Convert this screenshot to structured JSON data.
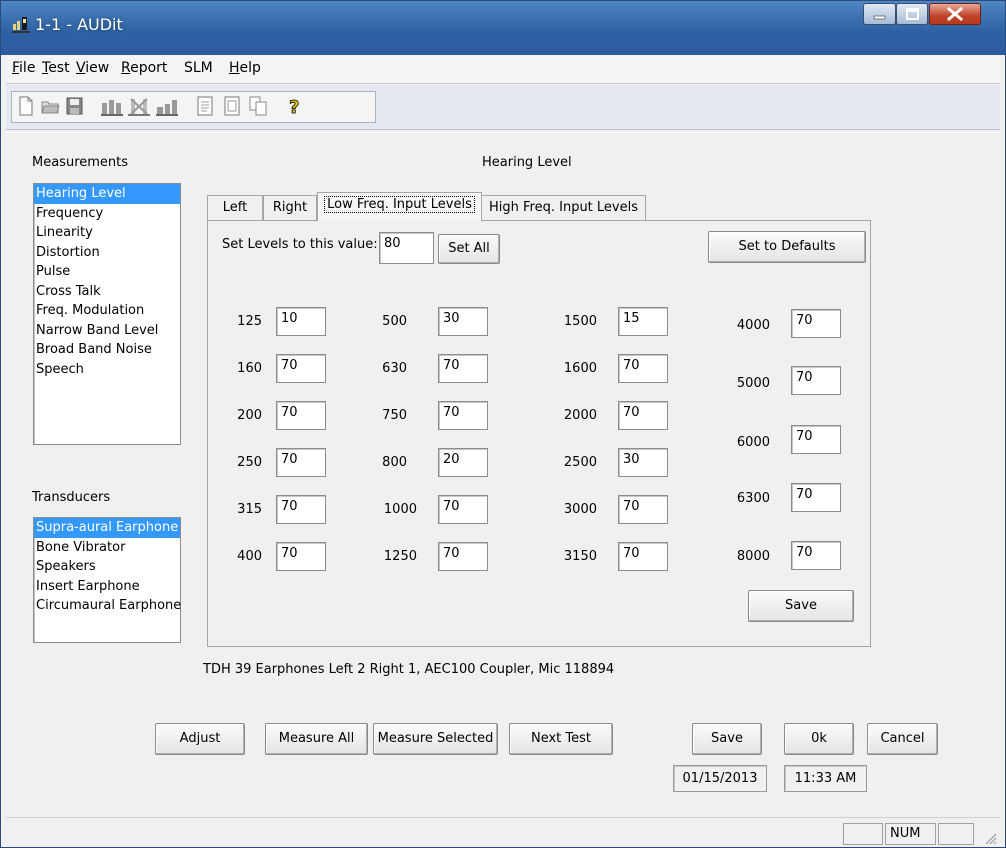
{
  "window": {
    "title": "1-1 - AUDit"
  },
  "menu": [
    {
      "underline": "F",
      "rest": "ile"
    },
    {
      "underline": "T",
      "rest": "est"
    },
    {
      "underline": "V",
      "rest": "iew"
    },
    {
      "underline": "R",
      "rest": "eport"
    },
    {
      "underline": "",
      "rest": "SLM"
    },
    {
      "underline": "H",
      "rest": "elp"
    }
  ],
  "toolbar": {
    "icons": [
      "new-file-icon",
      "open-folder-icon",
      "save-disk-icon",
      "measure-all-icon",
      "measure-selected-icon",
      "next-test-icon",
      "report-icon",
      "preview-icon",
      "copy-icon",
      "help-icon"
    ]
  },
  "measurements": {
    "label": "Measurements",
    "items": [
      "Hearing Level",
      "Frequency",
      "Linearity",
      "Distortion",
      "Pulse",
      "Cross Talk",
      "Freq. Modulation",
      "Narrow Band Level",
      "Broad Band Noise",
      "Speech"
    ],
    "selected": 0
  },
  "transducers": {
    "label": "Transducers",
    "items": [
      "Supra-aural Earphone",
      "Bone Vibrator",
      "Speakers",
      "Insert Earphone",
      "Circumaural Earphone"
    ],
    "selected": 0
  },
  "heading": "Hearing Level",
  "tabs": [
    "Left",
    "Right",
    "Low Freq. Input Levels",
    "High Freq. Input Levels"
  ],
  "active_tab": 2,
  "set_levels": {
    "label": "Set Levels to this value:",
    "value": "80",
    "set_all": "Set All",
    "defaults": "Set to Defaults"
  },
  "levels": {
    "col1": [
      {
        "freq": "125",
        "value": "10"
      },
      {
        "freq": "160",
        "value": "70"
      },
      {
        "freq": "200",
        "value": "70"
      },
      {
        "freq": "250",
        "value": "70"
      },
      {
        "freq": "315",
        "value": "70"
      },
      {
        "freq": "400",
        "value": "70"
      }
    ],
    "col2": [
      {
        "freq": "500",
        "value": "30"
      },
      {
        "freq": "630",
        "value": "70"
      },
      {
        "freq": "750",
        "value": "70"
      },
      {
        "freq": "800",
        "value": "20"
      },
      {
        "freq": "1000",
        "value": "70"
      },
      {
        "freq": "1250",
        "value": "70"
      }
    ],
    "col3": [
      {
        "freq": "1500",
        "value": "15"
      },
      {
        "freq": "1600",
        "value": "70"
      },
      {
        "freq": "2000",
        "value": "70"
      },
      {
        "freq": "2500",
        "value": "30"
      },
      {
        "freq": "3000",
        "value": "70"
      },
      {
        "freq": "3150",
        "value": "70"
      }
    ],
    "col4": [
      {
        "freq": "4000",
        "value": "70"
      },
      {
        "freq": "5000",
        "value": "70"
      },
      {
        "freq": "6000",
        "value": "70"
      },
      {
        "freq": "6300",
        "value": "70"
      },
      {
        "freq": "8000",
        "value": "70"
      }
    ]
  },
  "tab_save": "Save",
  "equipment": "TDH 39 Earphones Left 2 Right 1, AEC100 Coupler, Mic 118894",
  "buttons": {
    "adjust": "Adjust",
    "measure_all": "Measure All",
    "measure_selected": "Measure Selected",
    "next_test": "Next Test",
    "save": "Save",
    "ok": "0k",
    "cancel": "Cancel"
  },
  "date": "01/15/2013",
  "time": "11:33 AM",
  "statusbar": {
    "num": "NUM"
  }
}
